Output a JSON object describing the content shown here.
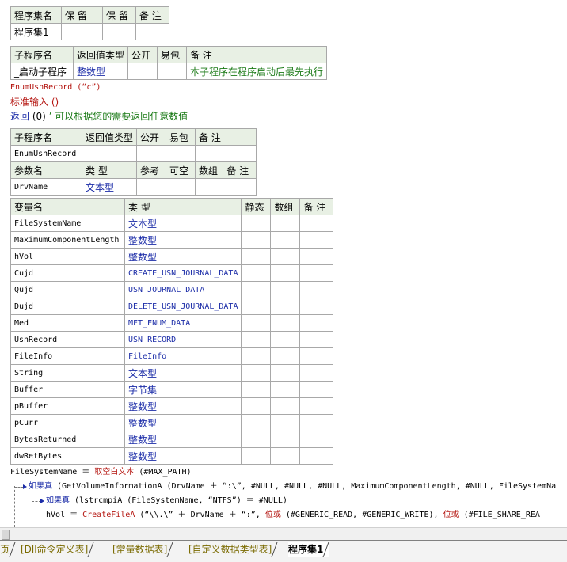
{
  "assembly_table": {
    "headers": [
      "程序集名",
      "保 留",
      "保 留",
      "备 注"
    ],
    "row": [
      "程序集1",
      "",
      "",
      ""
    ]
  },
  "sub_table": {
    "headers": [
      "子程序名",
      "返回值类型",
      "公开",
      "易包",
      "备 注"
    ],
    "row": [
      "_启动子程序",
      "整数型",
      "",
      "",
      "本子程序在程序启动后最先执行"
    ]
  },
  "startup_code": {
    "line1": "EnumUsnRecord (“c”)",
    "line2": "标准输入 ()",
    "line3_kw": "返回",
    "line3_rest": "(0)",
    "line3_comment": "’ 可以根据您的需要返回任意数值"
  },
  "enum_sub_table": {
    "headers": [
      "子程序名",
      "返回值类型",
      "公开",
      "易包",
      "备 注"
    ],
    "row": [
      "EnumUsnRecord",
      "",
      "",
      "",
      ""
    ],
    "param_headers": [
      "参数名",
      "类 型",
      "参考",
      "可空",
      "数组",
      "备 注"
    ],
    "param_row": [
      "DrvName",
      "文本型",
      "",
      "",
      "",
      ""
    ]
  },
  "var_table": {
    "headers": [
      "变量名",
      "类 型",
      "静态",
      "数组",
      "备 注"
    ],
    "rows": [
      [
        "FileSystemName",
        "文本型"
      ],
      [
        "MaximumComponentLength",
        "整数型"
      ],
      [
        "hVol",
        "整数型"
      ],
      [
        "Cujd",
        "CREATE_USN_JOURNAL_DATA"
      ],
      [
        "Qujd",
        "USN_JOURNAL_DATA"
      ],
      [
        "Dujd",
        "DELETE_USN_JOURNAL_DATA"
      ],
      [
        "Med",
        "MFT_ENUM_DATA"
      ],
      [
        "UsnRecord",
        "USN_RECORD"
      ],
      [
        "FileInfo",
        "FileInfo"
      ],
      [
        "String",
        "文本型"
      ],
      [
        "Buffer",
        "字节集"
      ],
      [
        "pBuffer",
        "整数型"
      ],
      [
        "pCurr",
        "整数型"
      ],
      [
        "BytesReturned",
        "整数型"
      ],
      [
        "dwRetBytes",
        "整数型"
      ]
    ]
  },
  "code": {
    "l1_a": "FileSystemName ＝ ",
    "l1_b": "取空白文本",
    "l1_c": " (#MAX_PATH)",
    "l2_kw": "如果真",
    "l2_rest": " (GetVolumeInformationA (DrvName ＋ “:\\”, #NULL, #NULL, #NULL, MaximumComponentLength, #NULL, FileSystemNa",
    "l3_kw": "如果真",
    "l3_rest": " (lstrcmpiA (FileSystemName, “NTFS”) ＝ #NULL)",
    "l4_a": "hVol ＝ ",
    "l4_b": "CreateFileA",
    "l4_c": " (“\\\\.\\” ＋ DrvName ＋ “:”, ",
    "l4_d": "位或",
    "l4_e": " (#GENERIC_READ, #GENERIC_WRITE), ",
    "l4_f": "位或",
    "l4_g": " (#FILE_SHARE_REA"
  },
  "tabs": [
    {
      "label": "页"
    },
    {
      "label": "[Dll命令定义表]"
    },
    {
      "label": "[常量数据表]"
    },
    {
      "label": "[自定义数据类型表]"
    },
    {
      "label": "程序集1",
      "active": true
    }
  ]
}
